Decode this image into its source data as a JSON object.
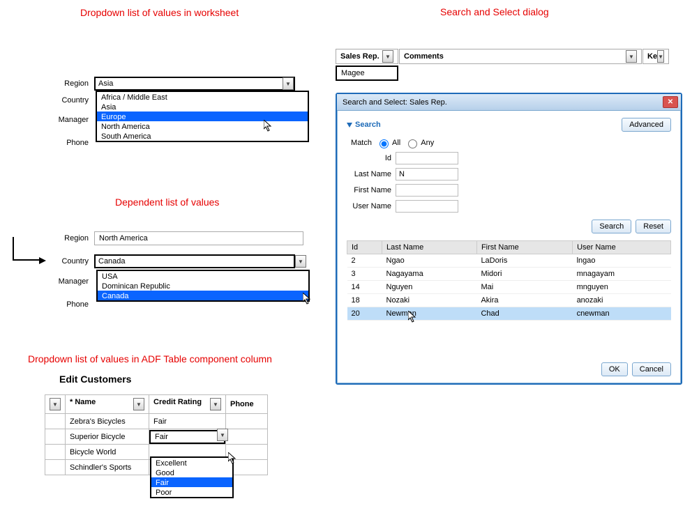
{
  "captions": {
    "worksheet_dd": "Dropdown list of values in worksheet",
    "search_dialog": "Search and Select dialog",
    "dependent": "Dependent list of values",
    "adf_col": "Dropdown list of values in ADF Table component column",
    "edit_customers": "Edit Customers"
  },
  "labels": {
    "region": "Region",
    "country": "Country",
    "manager": "Manager",
    "phone": "Phone"
  },
  "worksheet_dropdown": {
    "value": "Asia",
    "options": [
      "Africa / Middle East",
      "Asia",
      "Europe",
      "North America",
      "South America"
    ],
    "selected_index": 2
  },
  "dependent_dropdown": {
    "region_value": "North America",
    "country_value": "Canada",
    "options": [
      "USA",
      "Dominican Republic",
      "Canada"
    ],
    "selected_index": 2
  },
  "adf_table": {
    "columns": [
      "* Name",
      "Credit Rating",
      "Phone"
    ],
    "rows": [
      {
        "name": "Zebra's Bicycles",
        "rating": "Fair",
        "phone": ""
      },
      {
        "name": "Superior Bicycle",
        "rating": "Fair",
        "phone": ""
      },
      {
        "name": "Bicycle World",
        "rating": "",
        "phone": ""
      },
      {
        "name": "Schindler's Sports",
        "rating": "",
        "phone": ""
      }
    ],
    "rating_dropdown": {
      "value": "Fair",
      "options": [
        "Excellent",
        "Good",
        "Fair",
        "Poor"
      ],
      "selected_index": 2
    }
  },
  "worksheet_header": {
    "salesrep": "Sales Rep.",
    "comments": "Comments",
    "key_abbrev": "Ke",
    "salesrep_value": "Magee"
  },
  "dialog": {
    "title": "Search and Select: Sales Rep.",
    "search_label": "Search",
    "advanced_btn": "Advanced",
    "match_label": "Match",
    "all_label": "All",
    "any_label": "Any",
    "id_label": "Id",
    "lastname_label": "Last Name",
    "lastname_value": "N",
    "firstname_label": "First Name",
    "username_label": "User Name",
    "search_btn": "Search",
    "reset_btn": "Reset",
    "ok_btn": "OK",
    "cancel_btn": "Cancel",
    "columns": [
      "Id",
      "Last Name",
      "First Name",
      "User Name"
    ],
    "rows": [
      {
        "id": "2",
        "last": "Ngao",
        "first": "LaDoris",
        "user": "lngao"
      },
      {
        "id": "3",
        "last": "Nagayama",
        "first": "Midori",
        "user": "mnagayam"
      },
      {
        "id": "14",
        "last": "Nguyen",
        "first": "Mai",
        "user": "mnguyen"
      },
      {
        "id": "18",
        "last": "Nozaki",
        "first": "Akira",
        "user": "anozaki"
      },
      {
        "id": "20",
        "last": "Newman",
        "first": "Chad",
        "user": "cnewman"
      }
    ],
    "selected_row": 4
  }
}
